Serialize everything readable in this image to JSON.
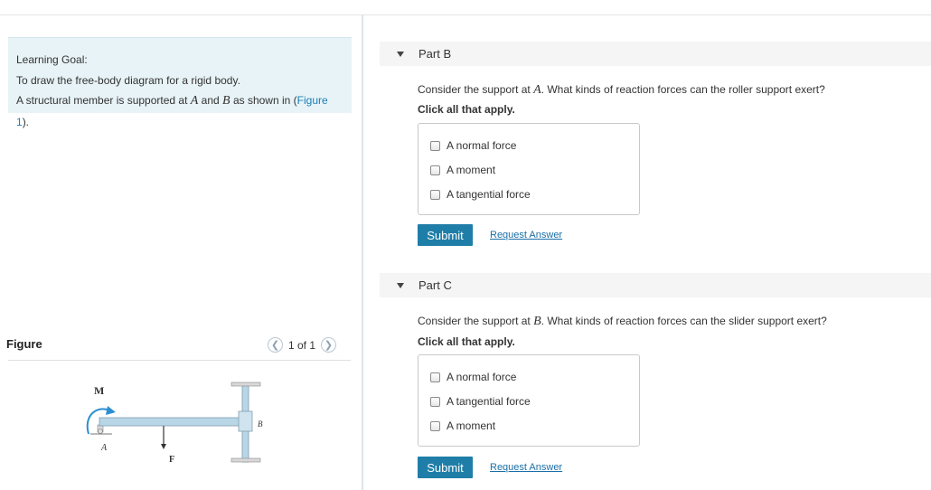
{
  "learning_goal": {
    "title": "Learning Goal:",
    "goal": "To draw the free-body diagram for a rigid body.",
    "description_pre": "A structural member is supported at",
    "var_a": "A",
    "and": "and",
    "var_b": "B",
    "description_post": "as shown in (",
    "figure_link": "Figure 1",
    "close": ")."
  },
  "figure_panel": {
    "title": "Figure",
    "pager_text": "1 of 1",
    "prev_icon": "chevron-left-icon",
    "next_icon": "chevron-right-icon",
    "labels": {
      "moment": "M",
      "support_a": "A",
      "support_b": "B",
      "force": "F"
    },
    "colors": {
      "beam": "#b8d6e6",
      "arrow": "#2b8fd0",
      "support": "#d8d8d8"
    }
  },
  "parts": [
    {
      "label": "Part B",
      "question_pre": "Consider the support at",
      "question_var": "A",
      "question_post": ". What kinds of reaction forces can the roller support exert?",
      "instruction": "Click all that apply.",
      "options": [
        "A normal force",
        "A moment",
        "A tangential force"
      ],
      "submit": "Submit",
      "request": "Request Answer"
    },
    {
      "label": "Part C",
      "question_pre": "Consider the support at",
      "question_var": "B",
      "question_post": ". What kinds of reaction forces can the slider support exert?",
      "instruction": "Click all that apply.",
      "options": [
        "A normal force",
        "A tangential force",
        "A moment"
      ],
      "submit": "Submit",
      "request": "Request Answer"
    }
  ],
  "colors": {
    "accent": "#1f7ea8",
    "link": "#1a7fb5",
    "goal_bg": "#e8f3f7"
  }
}
